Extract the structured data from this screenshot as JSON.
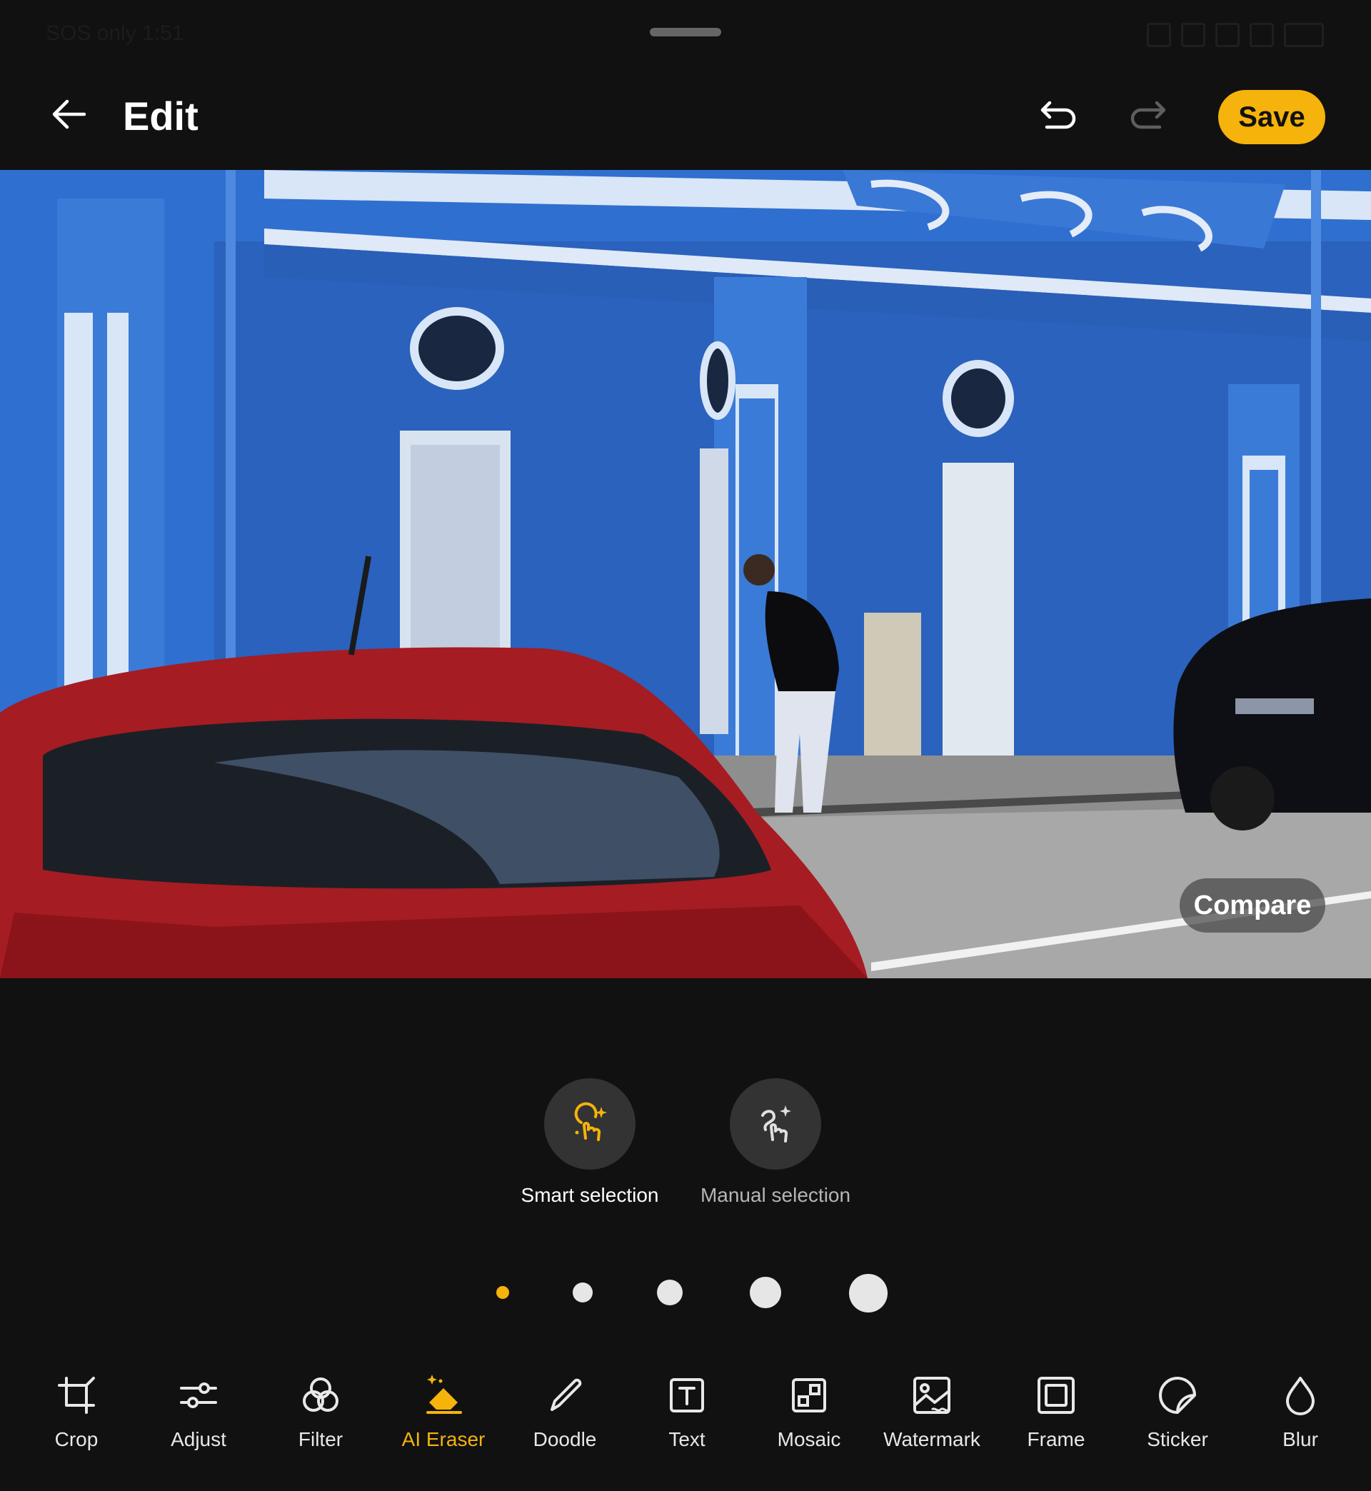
{
  "colors": {
    "background": "#111111",
    "accent": "#F5B30B",
    "icon": "#e8e8e8",
    "mode_circle": "#333333"
  },
  "status_bar": {
    "left_text": "SOS only 1:51"
  },
  "header": {
    "back_icon": "arrow-left-icon",
    "title": "Edit",
    "undo_icon": "undo-icon",
    "redo_icon": "redo-icon",
    "save_label": "Save"
  },
  "photo": {
    "compare_label": "Compare"
  },
  "selection_modes": [
    {
      "label": "Smart selection",
      "icon": "smart-selection-icon",
      "selected": true
    },
    {
      "label": "Manual selection",
      "icon": "manual-selection-icon",
      "selected": false
    }
  ],
  "brush_sizes": {
    "count": 5,
    "selected_index": 0
  },
  "toolbar": {
    "active_index": 3,
    "tools": [
      {
        "label": "Crop",
        "icon": "crop-icon"
      },
      {
        "label": "Adjust",
        "icon": "adjust-icon"
      },
      {
        "label": "Filter",
        "icon": "filter-icon"
      },
      {
        "label": "AI Eraser",
        "icon": "ai-eraser-icon"
      },
      {
        "label": "Doodle",
        "icon": "doodle-icon"
      },
      {
        "label": "Text",
        "icon": "text-icon"
      },
      {
        "label": "Mosaic",
        "icon": "mosaic-icon"
      },
      {
        "label": "Watermark",
        "icon": "watermark-icon"
      },
      {
        "label": "Frame",
        "icon": "frame-icon"
      },
      {
        "label": "Sticker",
        "icon": "sticker-icon"
      },
      {
        "label": "Blur",
        "icon": "blur-icon"
      }
    ]
  }
}
